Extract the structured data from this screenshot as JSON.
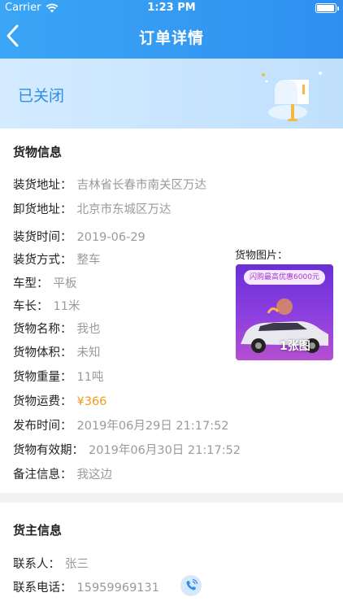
{
  "status_bar": {
    "carrier": "Carrier",
    "time": "1:23 PM",
    "battery_level": 1.0
  },
  "nav": {
    "title": "订单详情",
    "back_icon": "chevron-left-icon"
  },
  "banner": {
    "status": "已关闭",
    "illustration": "mailbox-icon"
  },
  "goods": {
    "section_title": "货物信息",
    "rows": [
      {
        "label": "装货地址：",
        "value": "吉林省长春市南关区万达"
      },
      {
        "label": "卸货地址：",
        "value": "北京市东城区万达"
      },
      {
        "label": "装货时间：",
        "value": "2019-06-29"
      },
      {
        "label": "装货方式：",
        "value": "整车"
      },
      {
        "label": "车型：",
        "value": "平板"
      },
      {
        "label": "车长：",
        "value": "11米"
      },
      {
        "label": "货物名称：",
        "value": "我也"
      },
      {
        "label": "货物体积：",
        "value": "未知"
      },
      {
        "label": "货物重量：",
        "value": "11吨"
      },
      {
        "label": "货物运费：",
        "value": "¥366"
      },
      {
        "label": "发布时间：",
        "value": "2019年06月29日 21:17:52"
      },
      {
        "label": "货物有效期：",
        "value": "2019年06月30日 21:17:52"
      },
      {
        "label": "备注信息：",
        "value": "我这边"
      }
    ],
    "picture_label": "货物图片：",
    "picture_promo": "闪购最高优惠6000元",
    "picture_count": "1张图"
  },
  "owner": {
    "section_title": "货主信息",
    "contact_label": "联系人：",
    "contact_value": "张三",
    "phone_label": "联系电话：",
    "phone_value": "15959969131",
    "phone_icon": "phone-icon"
  },
  "colors": {
    "accent": "#2f8ff0",
    "price": "#f39a1c",
    "muted": "#9a9a9a",
    "banner_text": "#2e8de6"
  }
}
